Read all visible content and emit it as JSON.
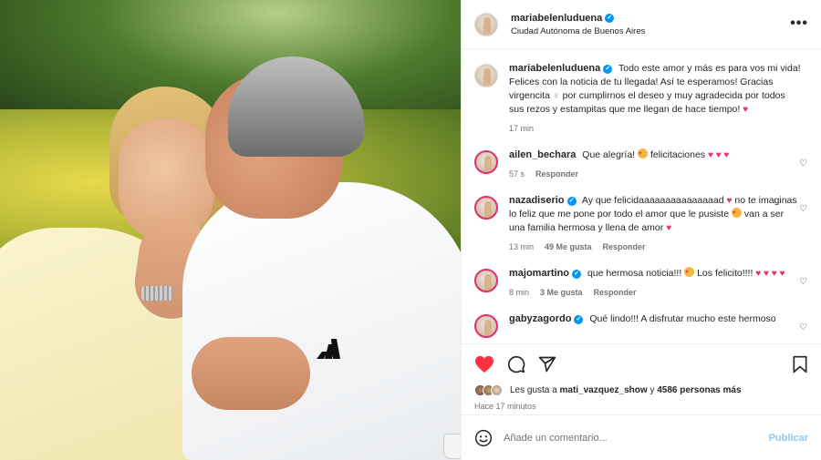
{
  "post": {
    "author": "mariabelenluduena",
    "location": "Ciudad Autónoma de Buenos Aires",
    "more_label": "•••"
  },
  "caption": {
    "author": "mariabelenluduena",
    "text_1": "Todo este amor y más es para vos mi vida! Felices con la noticia de tu llegada! Así te esperamos! Gracias virgencita",
    "text_2": "por cumplirnos el deseo y muy agradecida por todos sus rezos y estampitas que me llegan de hace tiempo!",
    "time": "17 min"
  },
  "comments": [
    {
      "author": "ailen_bechara",
      "verified": false,
      "text": "Que alegría!",
      "text_after": "felicitaciones",
      "time": "57 s",
      "likes": "",
      "reply": "Responder"
    },
    {
      "author": "nazadiserio",
      "verified": true,
      "text": "Ay que felicidaaaaaaaaaaaaaaad",
      "text_after": "no te imaginas lo feliz que me pone por todo el amor que le pusiste",
      "text_end": "van a ser una familia hermosa y llena de amor",
      "time": "13 min",
      "likes": "49 Me gusta",
      "reply": "Responder"
    },
    {
      "author": "majomartino",
      "verified": true,
      "text": "que hermosa noticia!!!",
      "text_after": "Los felicito!!!!",
      "time": "8 min",
      "likes": "3 Me gusta",
      "reply": "Responder"
    },
    {
      "author": "gabyzagordo",
      "verified": true,
      "text": "Qué lindo!!! A disfrutar mucho este hermoso",
      "time": "",
      "likes": "",
      "reply": ""
    }
  ],
  "likes": {
    "prefix": "Les gusta a",
    "user": "mati_vazquez_show",
    "connector": "y",
    "count": "4586 personas más",
    "time": "Hace 17 minutos"
  },
  "composer": {
    "placeholder": "Añade un comentario...",
    "post_label": "Publicar"
  },
  "icons": {
    "like": "heart-filled-icon",
    "comment": "comment-icon",
    "share": "share-icon",
    "save": "bookmark-icon",
    "emoji": "smile-icon"
  },
  "colors": {
    "like_red": "#ff3040",
    "verified_blue": "#0095f6",
    "publish_blue": "#8fc8f6"
  }
}
